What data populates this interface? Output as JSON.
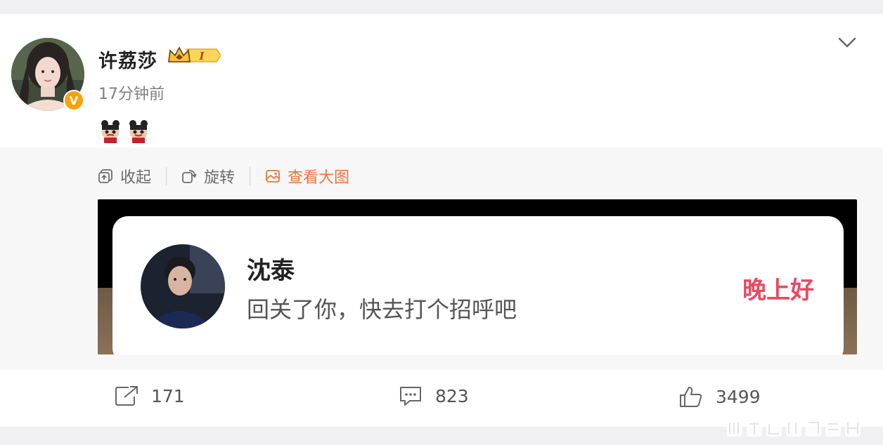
{
  "post": {
    "author": "许荔莎",
    "level_badge": "I",
    "time": "17分钟前",
    "verified_mark": "V"
  },
  "media_toolbar": {
    "collapse": "收起",
    "rotate": "旋转",
    "view_large": "查看大图"
  },
  "image_content": {
    "name": "沈泰",
    "message": "回关了你，快去打个招呼吧",
    "greeting": "晚上好"
  },
  "actions": {
    "repost_count": "171",
    "comment_count": "823",
    "like_count": "3499"
  },
  "colors": {
    "accent_orange": "#eb7340",
    "greeting_red": "#e84a5f",
    "verified_gold": "#f5a30c"
  }
}
